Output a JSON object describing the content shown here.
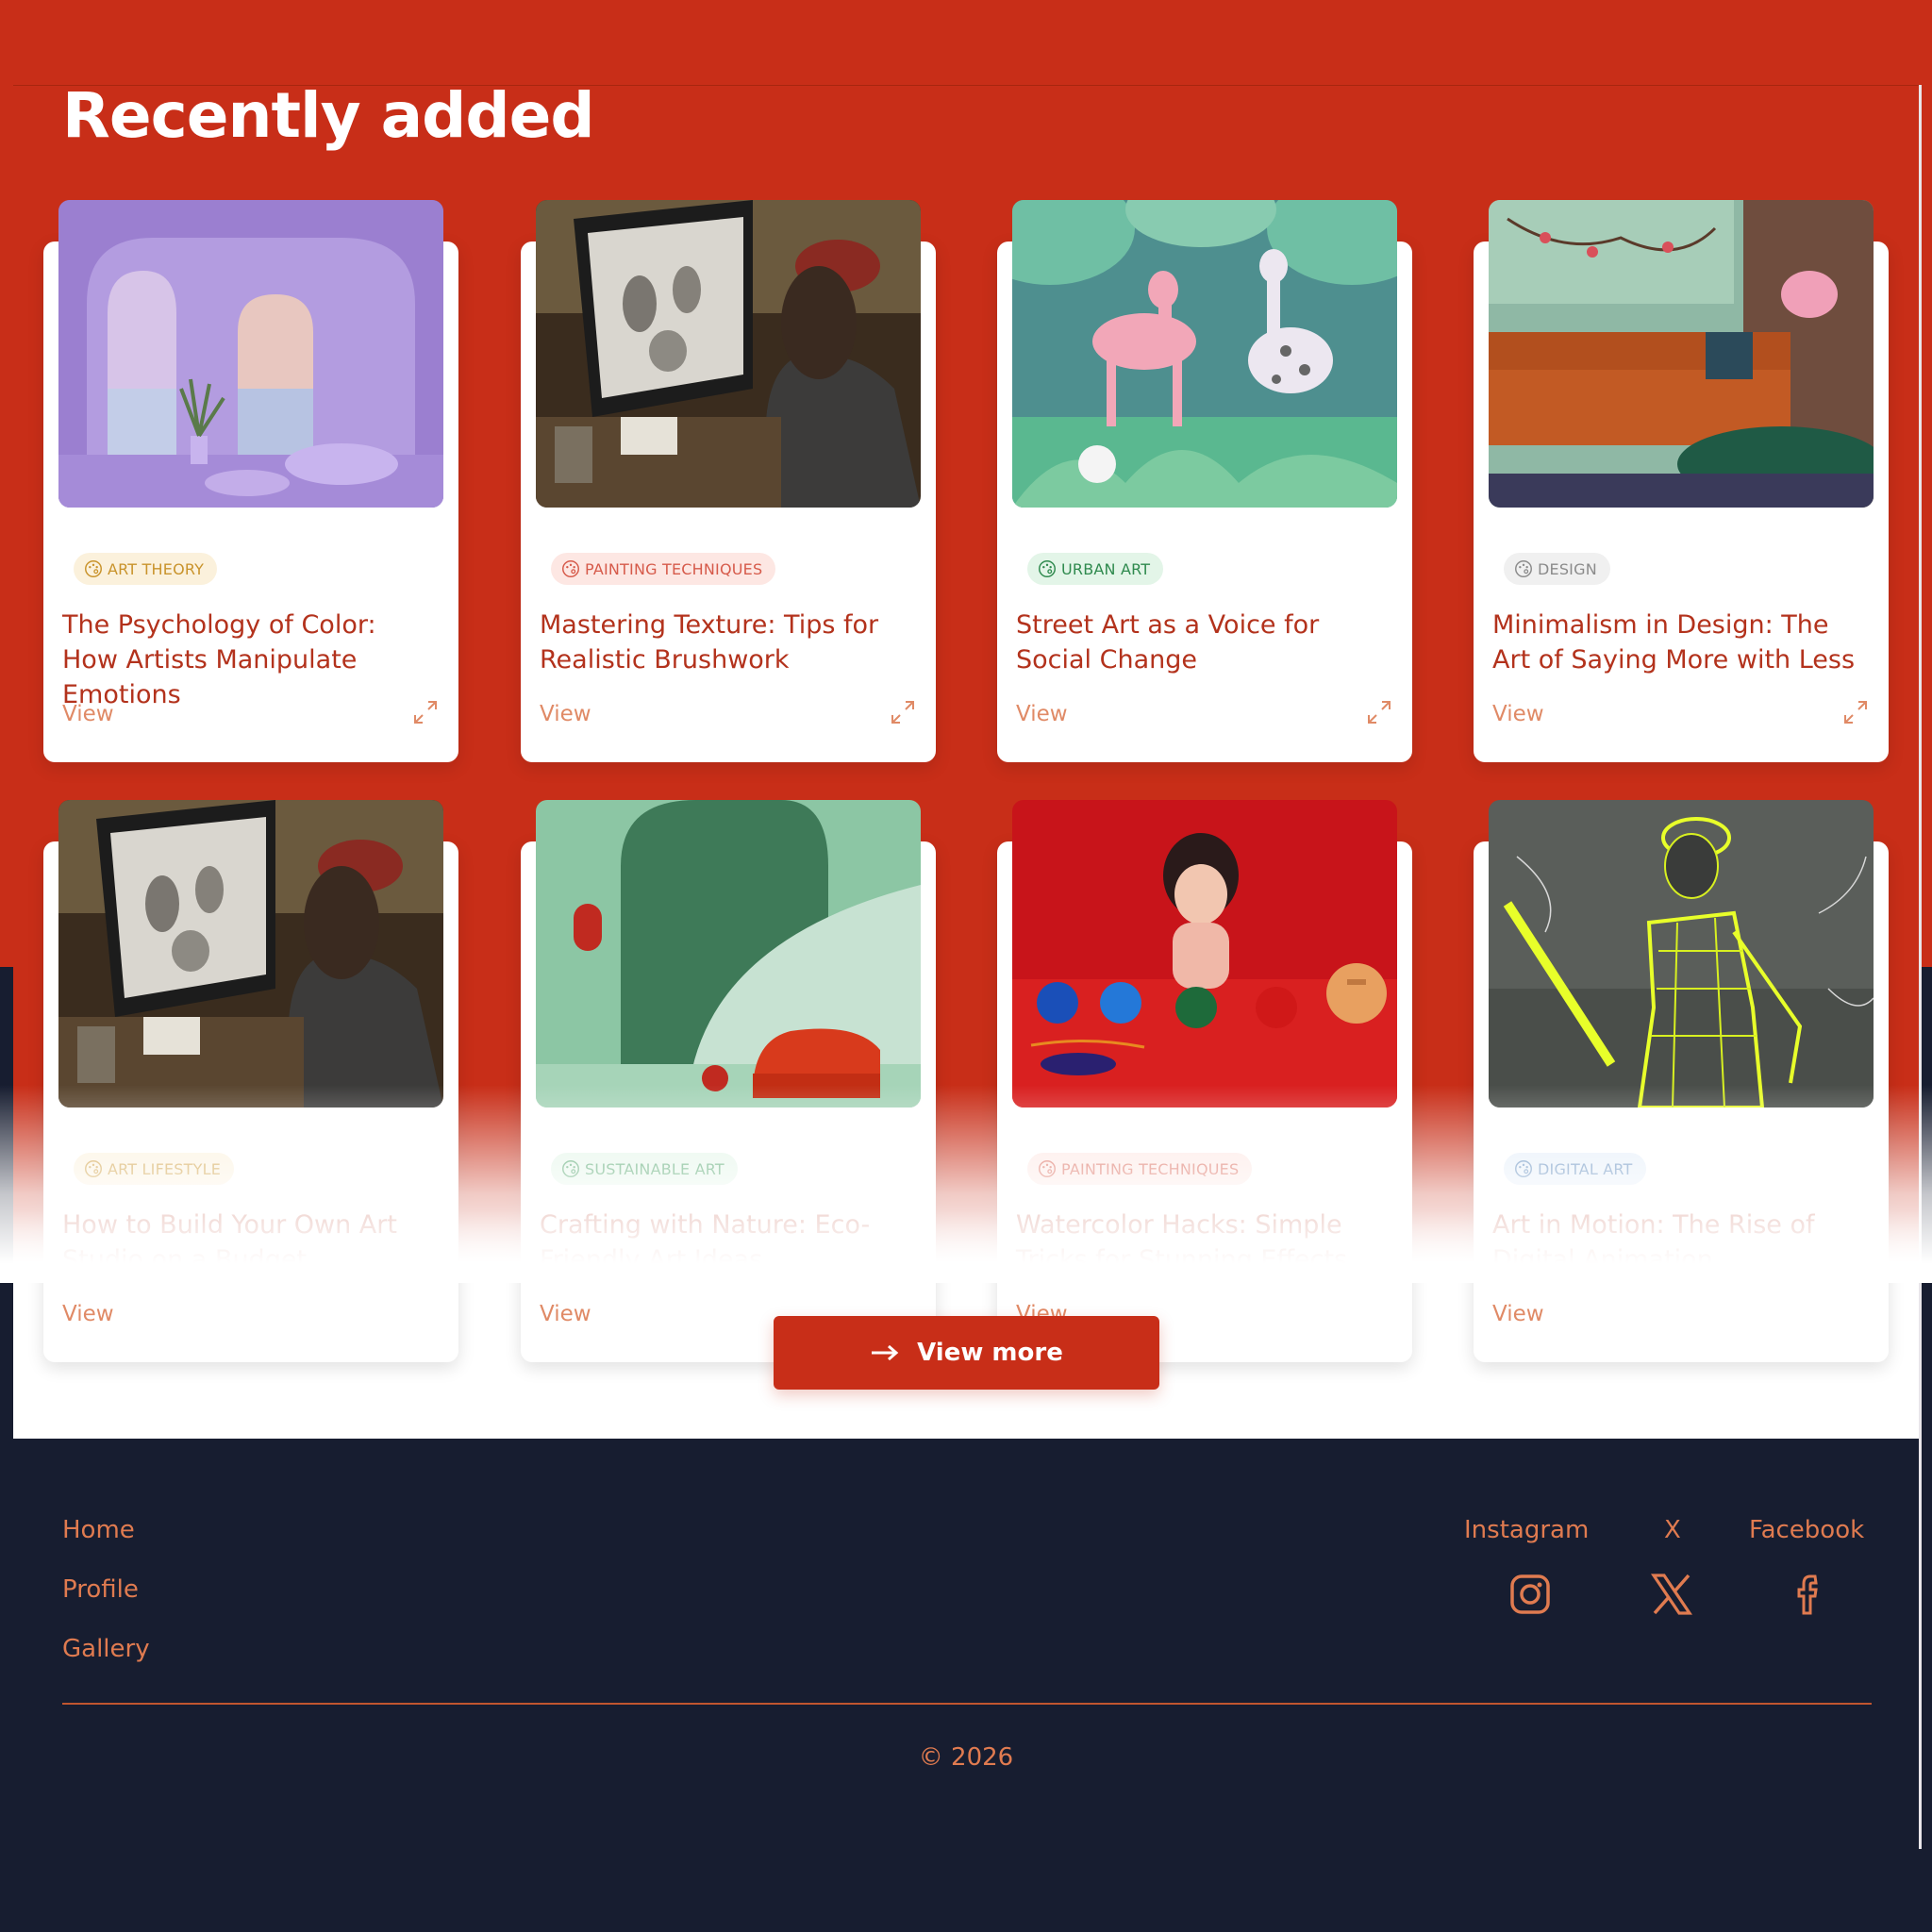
{
  "section": {
    "title": "Recently added"
  },
  "cards": [
    {
      "badge": "ART THEORY",
      "badge_color": "#c9932b",
      "badge_bg": "#fbf1dc",
      "title": "The Psychology of Color: How Artists Manipulate Emotions",
      "view": "View",
      "image": "purple arched room with sea view"
    },
    {
      "badge": "PAINTING TECHNIQUES",
      "badge_color": "#d65a4a",
      "badge_bg": "#fde7e3",
      "title": "Mastering Texture: Tips for Realistic Brushwork",
      "view": "View",
      "image": "artist drawing at a monitor in a workshop"
    },
    {
      "badge": "URBAN ART",
      "badge_color": "#2f8a4e",
      "badge_bg": "#e3f5e8",
      "title": "Street Art as a Voice for Social Change",
      "view": "View",
      "image": "paper-cut jungle with deer and giraffe"
    },
    {
      "badge": "DESIGN",
      "badge_color": "#8b8b8b",
      "badge_bg": "#f0f0f0",
      "title": "Minimalism in Design: The Art of Saying More with Less",
      "view": "View",
      "image": "living room with orange sofa"
    },
    {
      "badge": "ART LIFESTYLE",
      "badge_color": "#c9932b",
      "badge_bg": "#fbf1dc",
      "title": "How to Build Your Own Art Studio on a Budget",
      "view": "View",
      "image": "artist drawing at a monitor in a workshop"
    },
    {
      "badge": "SUSTAINABLE ART",
      "badge_color": "#3f9a5c",
      "badge_bg": "#e3f5e8",
      "title": "Crafting with Nature: Eco-Friendly Art Ideas",
      "view": "View",
      "image": "green arched room with red armchair"
    },
    {
      "badge": "PAINTING TECHNIQUES",
      "badge_color": "#d65a4a",
      "badge_bg": "#fde7e3",
      "title": "Watercolor Hacks: Simple Tricks for Stunning Effects",
      "view": "View",
      "image": "girl with colourful balls on red table"
    },
    {
      "badge": "DIGITAL ART",
      "badge_color": "#4f7fb5",
      "badge_bg": "#e4eef9",
      "title": "Art in Motion: The Rise of Digital Animation",
      "view": "View",
      "image": "neon wireframe tennis player"
    }
  ],
  "view_more": {
    "label": "View more"
  },
  "footer": {
    "links": [
      "Home",
      "Profile",
      "Gallery"
    ],
    "social": [
      {
        "label": "Instagram",
        "icon": "instagram-icon"
      },
      {
        "label": "X",
        "icon": "x-icon"
      },
      {
        "label": "Facebook",
        "icon": "facebook-icon"
      }
    ],
    "copyright": "© 2026"
  },
  "colors": {
    "brand_red": "#c82e18",
    "footer_bg": "#171d30",
    "accent_orange": "#e07b50",
    "card_title": "#b3321c"
  }
}
